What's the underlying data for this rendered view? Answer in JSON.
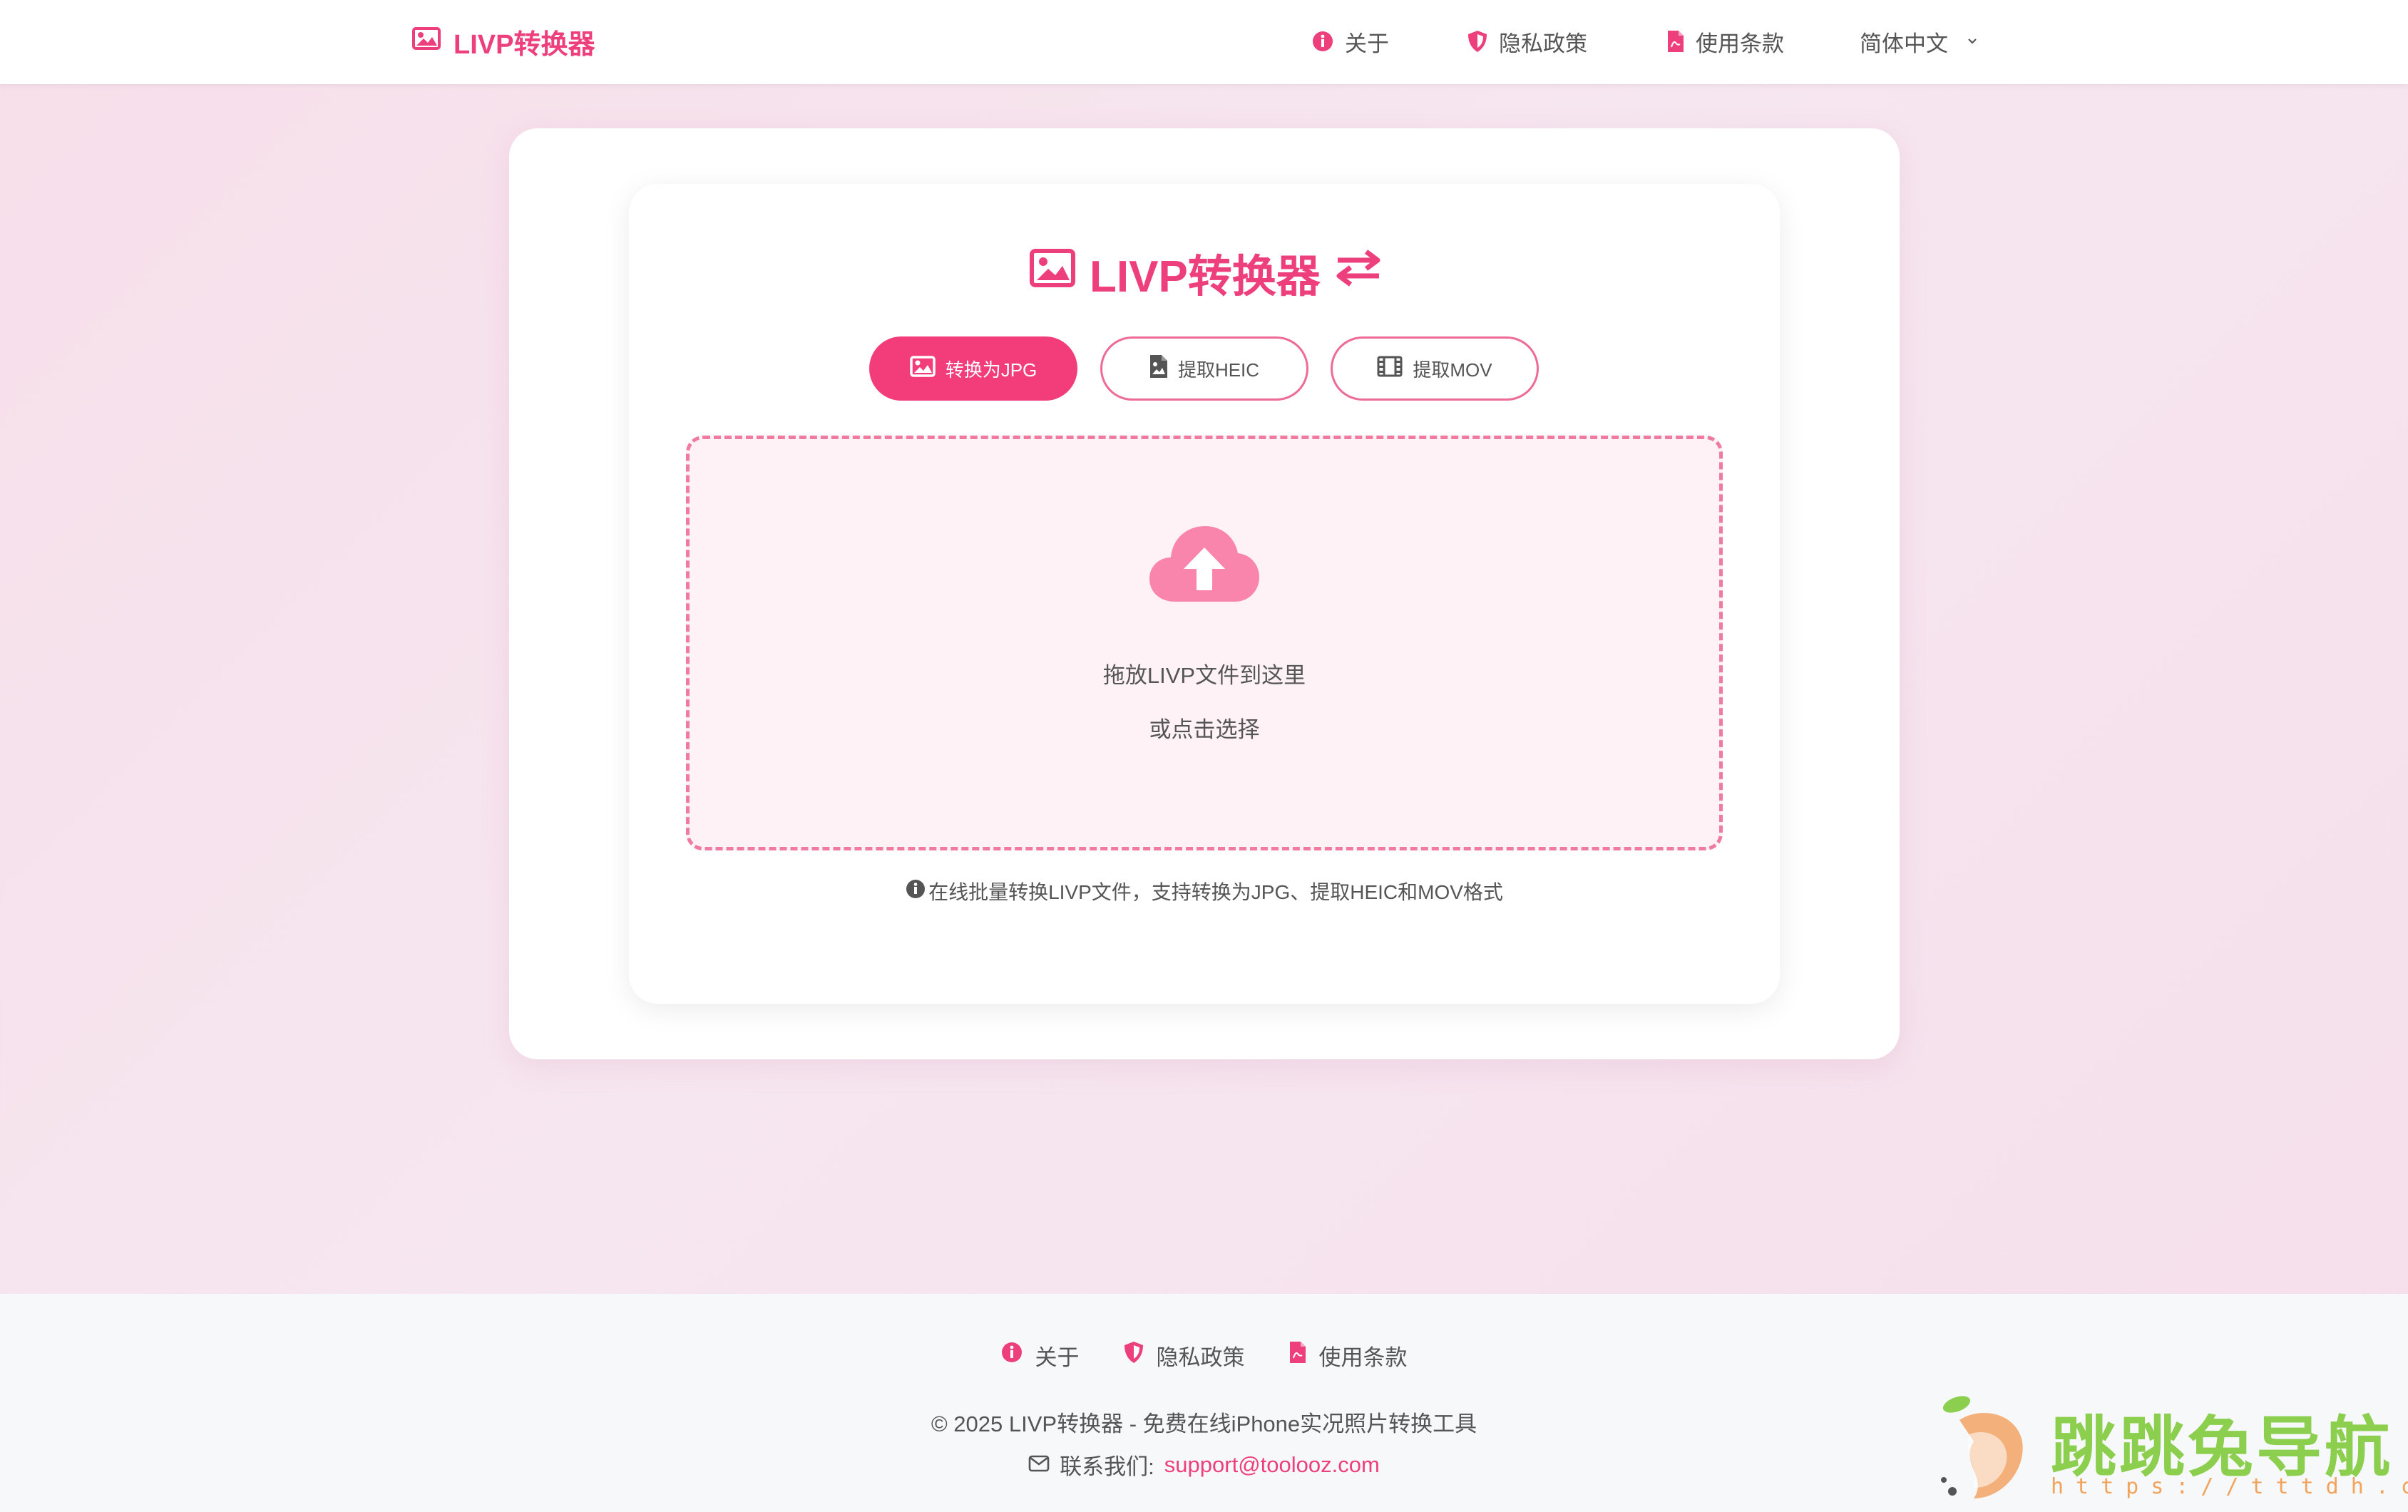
{
  "header": {
    "brand": "LIVP转换器",
    "nav": {
      "about": "关于",
      "privacy": "隐私政策",
      "terms": "使用条款",
      "language": "简体中文"
    }
  },
  "main": {
    "title": "LIVP转换器",
    "tabs": [
      {
        "label": "转换为JPG",
        "icon": "image-icon",
        "active": true
      },
      {
        "label": "提取HEIC",
        "icon": "file-image-icon",
        "active": false
      },
      {
        "label": "提取MOV",
        "icon": "film-icon",
        "active": false
      }
    ],
    "dropzone": {
      "line1": "拖放LIVP文件到这里",
      "line2": "或点击选择"
    },
    "hint": "在线批量转换LIVP文件，支持转换为JPG、提取HEIC和MOV格式"
  },
  "footer": {
    "links": {
      "about": "关于",
      "privacy": "隐私政策",
      "terms": "使用条款"
    },
    "copyright": "© 2025 LIVP转换器 - 免费在线iPhone实况照片转换工具",
    "contact_label": "联系我们:",
    "contact_email": "support@toolooz.com"
  },
  "watermark": {
    "title": "跳跳兔导航",
    "url": "https://tttdh.com"
  },
  "colors": {
    "accent": "#ee3f7d",
    "dropzone_border": "#f07ba1",
    "dropzone_bg": "#fef2f6",
    "cloud": "#f985ad",
    "watermark_green": "#8ccf4e",
    "watermark_orange": "#f2a35c"
  }
}
